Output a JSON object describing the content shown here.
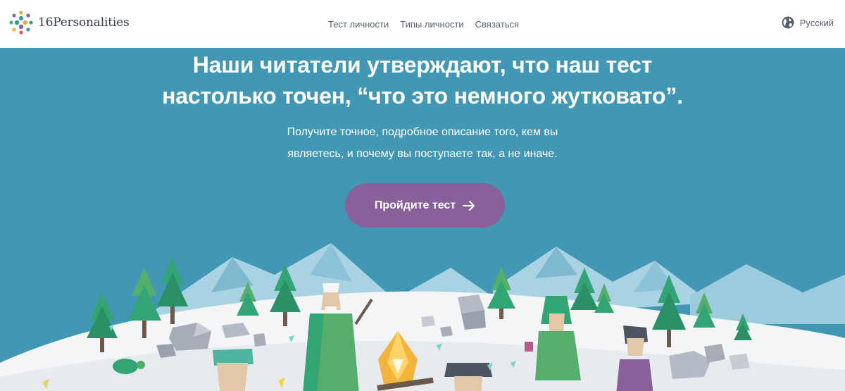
{
  "brand": {
    "name": "16Personalities",
    "dot_colors": [
      "#e4ae3a",
      "#88619a",
      "#33a474",
      "#4298b4",
      "#d05a4c",
      "#56ae6c",
      "#f2b43c",
      "#8a6aa8"
    ]
  },
  "nav": {
    "items": [
      {
        "label": "Тест личности"
      },
      {
        "label": "Типы личности"
      },
      {
        "label": "Связаться"
      }
    ]
  },
  "language": {
    "label": "Русский",
    "icon": "globe-icon"
  },
  "hero": {
    "title_line1": "Наши читатели утверждают, что наш тест",
    "title_line2": "настолько точен, “что это немного жутковато”.",
    "subtitle_line1": "Получите точное, подробное описание того, кем вы",
    "subtitle_line2": "являетесь, и почему вы поступаете так, а не иначе.",
    "cta_label": "Пройдите тест",
    "cta_icon": "arrow-right-icon"
  },
  "colors": {
    "hero_bg": "#4298b4",
    "cta_bg": "#88619a",
    "nav_text": "#576071"
  }
}
